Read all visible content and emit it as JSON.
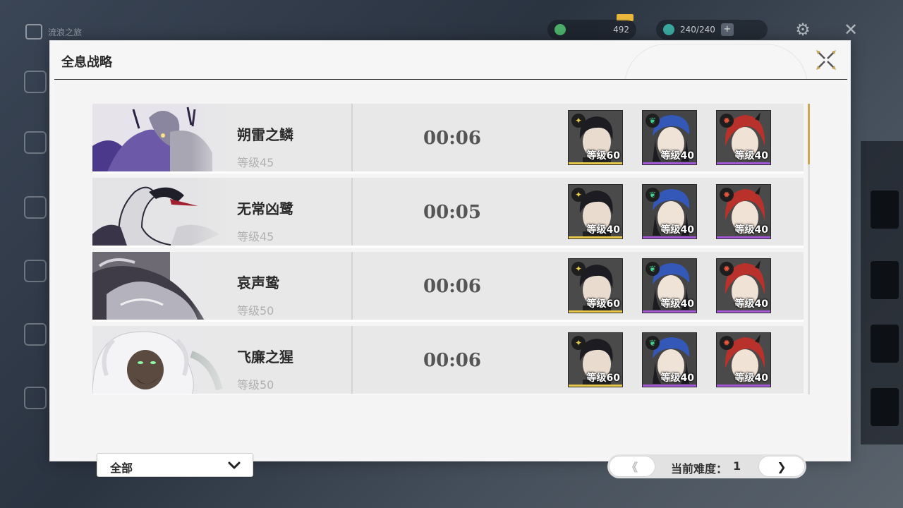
{
  "background": {
    "home_label": "流浪之旅",
    "currency1": "492",
    "currency2": "240/240"
  },
  "panel": {
    "title": "全息战略"
  },
  "bosses": [
    {
      "name": "朔雷之鳞",
      "level": "等级45",
      "time": "00:06",
      "team": [
        {
          "element": "spectro",
          "level": "等级60",
          "rarity_color": "#e8c84a"
        },
        {
          "element": "aero",
          "level": "等级40",
          "rarity_color": "#a45ad8"
        },
        {
          "element": "fusion",
          "level": "等级40",
          "rarity_color": "#a45ad8"
        }
      ]
    },
    {
      "name": "无常凶鹭",
      "level": "等级45",
      "time": "00:05",
      "team": [
        {
          "element": "spectro",
          "level": "等级40",
          "rarity_color": "#e8c84a"
        },
        {
          "element": "aero",
          "level": "等级40",
          "rarity_color": "#a45ad8"
        },
        {
          "element": "fusion",
          "level": "等级40",
          "rarity_color": "#a45ad8"
        }
      ]
    },
    {
      "name": "哀声鸷",
      "level": "等级50",
      "time": "00:06",
      "team": [
        {
          "element": "spectro",
          "level": "等级60",
          "rarity_color": "#e8c84a"
        },
        {
          "element": "aero",
          "level": "等级40",
          "rarity_color": "#a45ad8"
        },
        {
          "element": "fusion",
          "level": "等级40",
          "rarity_color": "#a45ad8"
        }
      ]
    },
    {
      "name": "飞廉之猩",
      "level": "等级50",
      "time": "00:06",
      "team": [
        {
          "element": "spectro",
          "level": "等级60",
          "rarity_color": "#e8c84a"
        },
        {
          "element": "aero",
          "level": "等级40",
          "rarity_color": "#a45ad8"
        },
        {
          "element": "fusion",
          "level": "等级40",
          "rarity_color": "#a45ad8"
        }
      ]
    }
  ],
  "footer": {
    "filter_value": "全部",
    "difficulty_label": "当前难度：",
    "difficulty_value": "1",
    "prev_icon": "chevron-left",
    "next_icon": "chevron-right"
  },
  "colors": {
    "accent_gold": "#c8a95a",
    "spectro": "#e8c84a",
    "aero": "#3fcf8e",
    "fusion": "#e0553a"
  }
}
